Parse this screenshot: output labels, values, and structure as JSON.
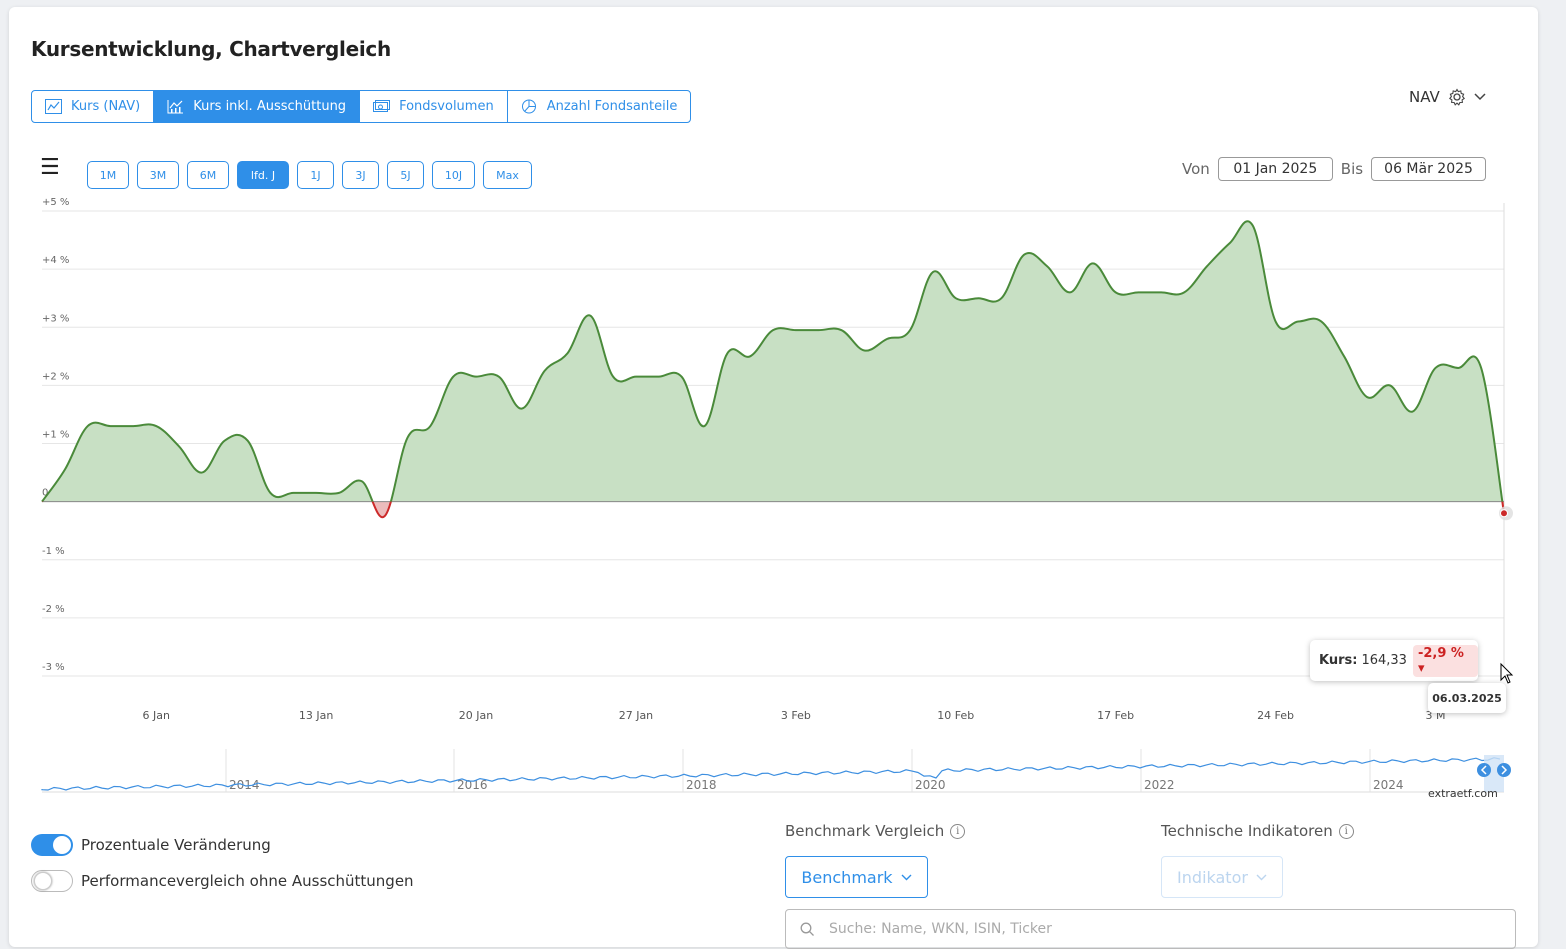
{
  "page_title": "Kursentwicklung, Chartvergleich",
  "tabs": [
    {
      "label": "Kurs (NAV)",
      "icon": "line-chart-icon"
    },
    {
      "label": "Kurs inkl. Ausschüttung",
      "icon": "bar-line-chart-icon"
    },
    {
      "label": "Fondsvolumen",
      "icon": "money-icon"
    },
    {
      "label": "Anzahl Fondsanteile",
      "icon": "pie-chart-icon"
    }
  ],
  "active_tab": "Kurs inkl. Ausschüttung",
  "nav_select": {
    "label": "NAV",
    "icon": "gear-icon"
  },
  "ranges": [
    "1M",
    "3M",
    "6M",
    "lfd. J",
    "1J",
    "3J",
    "5J",
    "10J",
    "Max"
  ],
  "active_range": "lfd. J",
  "date_range": {
    "from_label": "Von",
    "from_value": "01 Jan 2025",
    "to_label": "Bis",
    "to_value": "06 Mär 2025"
  },
  "watermark": "extraETF",
  "tooltip": {
    "label": "Kurs:",
    "value": "164,33",
    "change": "-2,9 %",
    "date": "06.03.2025"
  },
  "credit": "extraetf.com",
  "toggles": [
    {
      "label": "Prozentuale Veränderung",
      "on": true
    },
    {
      "label": "Performancevergleich ohne Ausschüttungen",
      "on": false
    }
  ],
  "benchmark": {
    "title": "Benchmark Vergleich",
    "button": "Benchmark",
    "search_placeholder": "Suche: Name, WKN, ISIN, Ticker"
  },
  "indicators": {
    "title": "Technische Indikatoren",
    "button": "Indikator"
  },
  "colors": {
    "accent": "#2f8fe8",
    "positive_line": "#4a8a3a",
    "positive_fill": "#c8e0c4",
    "negative_line": "#cc2a2a",
    "negative_fill": "#ecbcbc"
  },
  "chart_data": {
    "type": "area",
    "ylabel": "",
    "xlabel": "",
    "ylim": [
      -3,
      5
    ],
    "yticks": [
      "+5 %",
      "+4 %",
      "+3 %",
      "+2 %",
      "+1 %",
      "0 %",
      "-1 %",
      "-2 %",
      "-3 %"
    ],
    "ytick_values": [
      5,
      4,
      3,
      2,
      1,
      0,
      -1,
      -2,
      -3
    ],
    "xticks": [
      "6 Jan",
      "13 Jan",
      "20 Jan",
      "27 Jan",
      "3 Feb",
      "10 Feb",
      "17 Feb",
      "24 Feb",
      "3 M"
    ],
    "xtick_days": [
      5,
      12,
      19,
      26,
      33,
      40,
      47,
      54,
      61
    ],
    "x_start": "01.01.2025",
    "x_end": "06.03.2025",
    "x": [
      0,
      1,
      2,
      3,
      4,
      5,
      6,
      7,
      8,
      9,
      10,
      11,
      12,
      13,
      14,
      15,
      16,
      17,
      18,
      19,
      20,
      21,
      22,
      23,
      24,
      25,
      26,
      27,
      28,
      29,
      30,
      31,
      32,
      33,
      34,
      35,
      36,
      37,
      38,
      39,
      40,
      41,
      42,
      43,
      44,
      45,
      46,
      47,
      48,
      49,
      50,
      51,
      52,
      53,
      54,
      55,
      56,
      57,
      58,
      59,
      60,
      61,
      62,
      63,
      64
    ],
    "series": [
      {
        "values": [
          0.0,
          0.55,
          1.3,
          1.3,
          1.3,
          1.3,
          0.95,
          0.5,
          1.05,
          1.05,
          0.15,
          0.15,
          0.15,
          0.15,
          0.35,
          -0.25,
          1.1,
          1.3,
          2.15,
          2.15,
          2.15,
          1.6,
          2.25,
          2.55,
          3.2,
          2.15,
          2.15,
          2.15,
          2.15,
          1.3,
          2.55,
          2.5,
          2.95,
          2.95,
          2.95,
          2.95,
          2.6,
          2.8,
          2.95,
          3.95,
          3.5,
          3.5,
          3.5,
          4.25,
          4.05,
          3.6,
          4.1,
          3.6,
          3.6,
          3.6,
          3.6,
          4.05,
          4.45,
          4.75,
          3.1,
          3.1,
          3.1,
          2.5,
          1.8,
          2.0,
          1.55,
          2.3,
          2.3,
          2.3,
          -0.2
        ]
      }
    ]
  },
  "navigator": {
    "labels": [
      "2014",
      "2016",
      "2018",
      "2020",
      "2022",
      "2024"
    ]
  }
}
